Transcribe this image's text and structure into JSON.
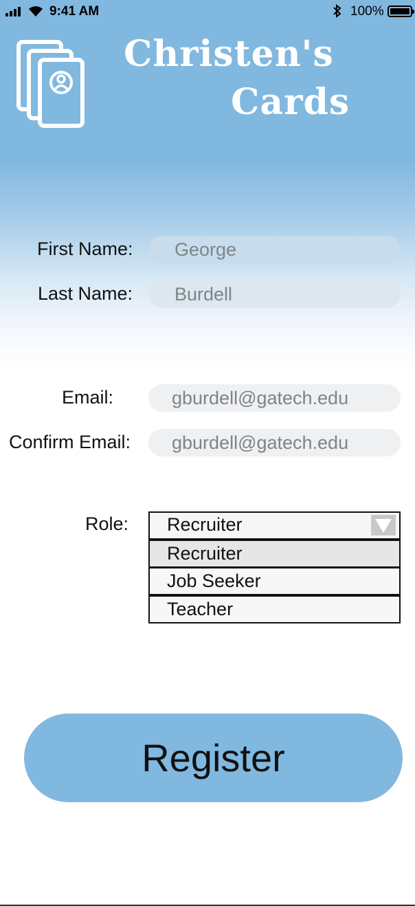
{
  "status_bar": {
    "time": "9:41 AM",
    "battery": "100%"
  },
  "header": {
    "title_line1": "Christen's",
    "title_line2": "Cards",
    "logo_icon": "id-cards-icon"
  },
  "form": {
    "first_name_label": "First Name:",
    "first_name_value": "George",
    "last_name_label": "Last Name:",
    "last_name_value": "Burdell",
    "email_label": "Email:",
    "email_value": "gburdell@gatech.edu",
    "confirm_email_label": "Confirm Email:",
    "confirm_email_value": "gburdell@gatech.edu",
    "role_label": "Role:",
    "role_selected": "Recruiter",
    "role_options": [
      "Recruiter",
      "Job Seeker",
      "Teacher"
    ]
  },
  "register_label": "Register",
  "colors": {
    "accent": "#81b8df",
    "title": "#ffffff"
  }
}
